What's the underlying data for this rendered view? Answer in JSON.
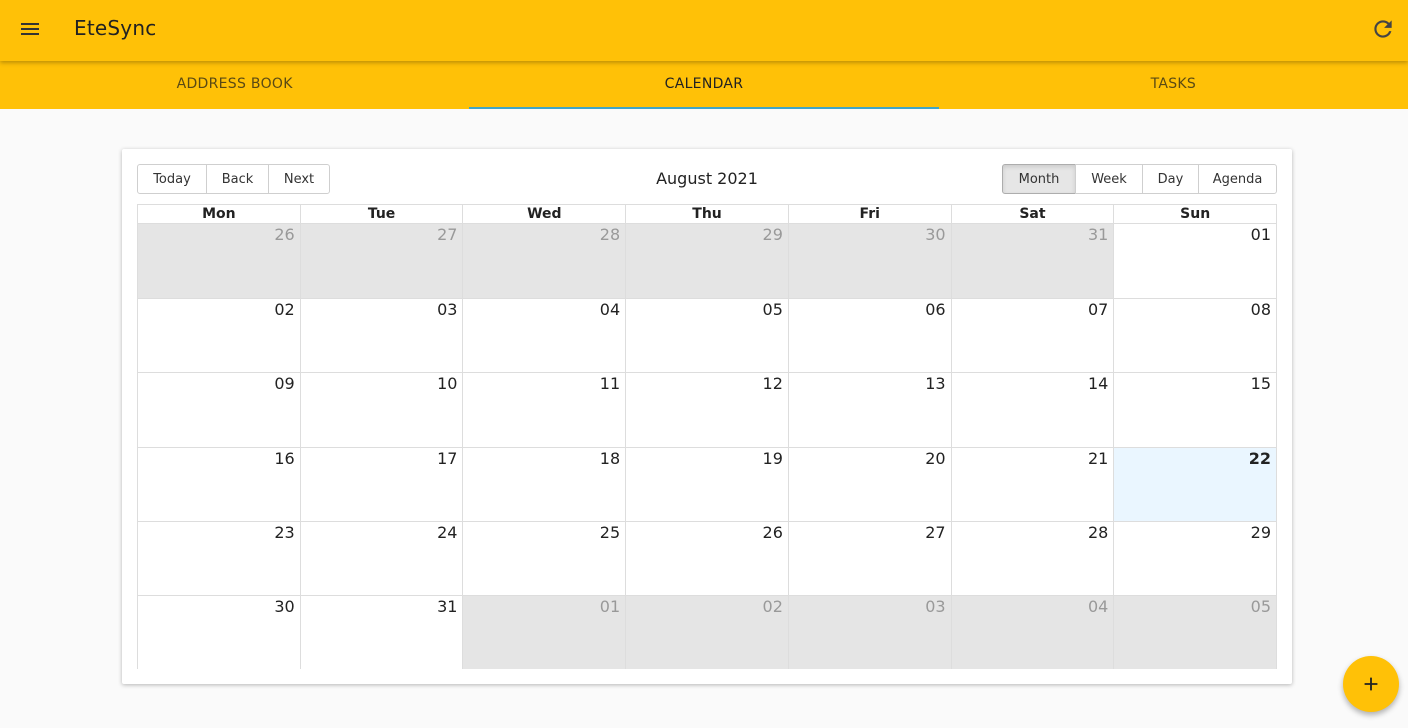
{
  "app": {
    "title": "EteSync"
  },
  "icons": {
    "menu": "menu-icon",
    "refresh": "refresh-icon",
    "add": "add-icon"
  },
  "colors": {
    "primary": "#ffc107",
    "tab_indicator": "#3fa5c8",
    "today_bg": "#eaf6ff",
    "off_range_bg": "#e5e5e5"
  },
  "tabs": [
    {
      "label": "ADDRESS BOOK",
      "active": false
    },
    {
      "label": "CALENDAR",
      "active": true
    },
    {
      "label": "TASKS",
      "active": false
    }
  ],
  "calendar": {
    "nav": {
      "today": "Today",
      "back": "Back",
      "next": "Next"
    },
    "label": "August 2021",
    "views": {
      "month": "Month",
      "week": "Week",
      "day": "Day",
      "agenda": "Agenda",
      "active": "Month"
    },
    "weekdays": [
      "Mon",
      "Tue",
      "Wed",
      "Thu",
      "Fri",
      "Sat",
      "Sun"
    ],
    "weeks": [
      {
        "days": [
          {
            "num": "26",
            "off": true
          },
          {
            "num": "27",
            "off": true
          },
          {
            "num": "28",
            "off": true
          },
          {
            "num": "29",
            "off": true
          },
          {
            "num": "30",
            "off": true
          },
          {
            "num": "31",
            "off": true
          },
          {
            "num": "01",
            "off": false
          }
        ]
      },
      {
        "days": [
          {
            "num": "02",
            "off": false
          },
          {
            "num": "03",
            "off": false
          },
          {
            "num": "04",
            "off": false
          },
          {
            "num": "05",
            "off": false
          },
          {
            "num": "06",
            "off": false
          },
          {
            "num": "07",
            "off": false
          },
          {
            "num": "08",
            "off": false
          }
        ]
      },
      {
        "days": [
          {
            "num": "09",
            "off": false
          },
          {
            "num": "10",
            "off": false
          },
          {
            "num": "11",
            "off": false
          },
          {
            "num": "12",
            "off": false
          },
          {
            "num": "13",
            "off": false
          },
          {
            "num": "14",
            "off": false
          },
          {
            "num": "15",
            "off": false
          }
        ]
      },
      {
        "days": [
          {
            "num": "16",
            "off": false
          },
          {
            "num": "17",
            "off": false
          },
          {
            "num": "18",
            "off": false
          },
          {
            "num": "19",
            "off": false
          },
          {
            "num": "20",
            "off": false
          },
          {
            "num": "21",
            "off": false
          },
          {
            "num": "22",
            "off": false,
            "today": true
          }
        ]
      },
      {
        "days": [
          {
            "num": "23",
            "off": false
          },
          {
            "num": "24",
            "off": false
          },
          {
            "num": "25",
            "off": false
          },
          {
            "num": "26",
            "off": false
          },
          {
            "num": "27",
            "off": false
          },
          {
            "num": "28",
            "off": false
          },
          {
            "num": "29",
            "off": false
          }
        ]
      },
      {
        "days": [
          {
            "num": "30",
            "off": false
          },
          {
            "num": "31",
            "off": false
          },
          {
            "num": "01",
            "off": true
          },
          {
            "num": "02",
            "off": true
          },
          {
            "num": "03",
            "off": true
          },
          {
            "num": "04",
            "off": true
          },
          {
            "num": "05",
            "off": true
          }
        ]
      }
    ]
  }
}
